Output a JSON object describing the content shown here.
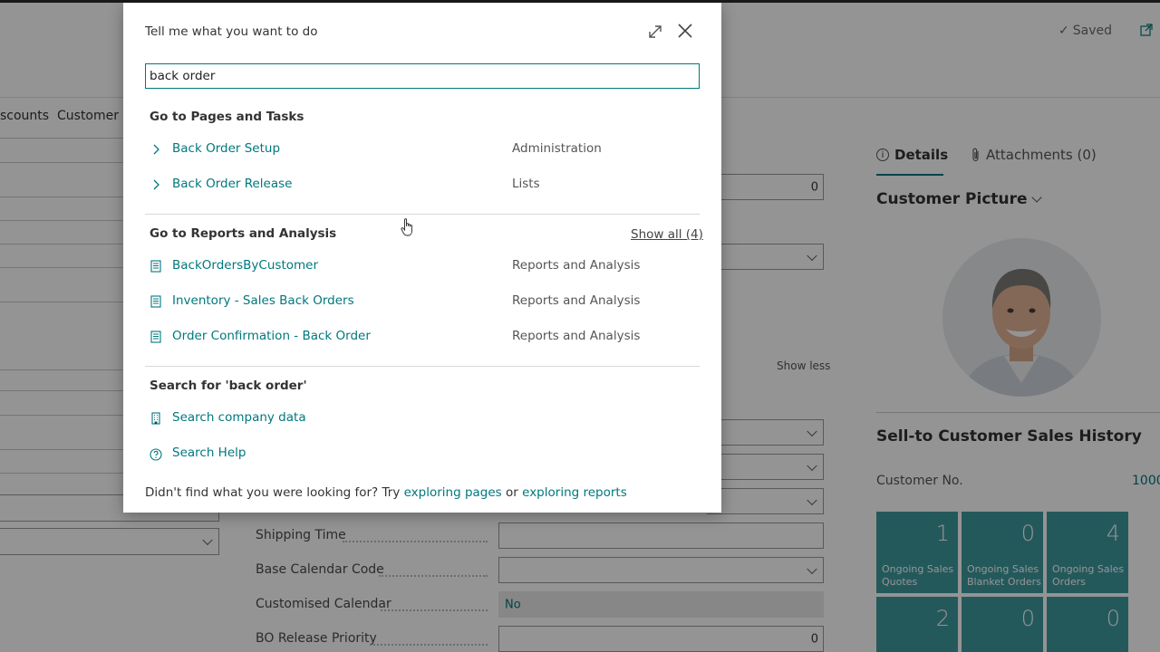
{
  "background": {
    "saved_label": "Saved",
    "nav_actions": [
      "scounts",
      "Customer"
    ],
    "numeric_field_value": "0",
    "show_less": "Show less",
    "fields": [
      {
        "label": "Shipping Time",
        "value": ""
      },
      {
        "label": "Base Calendar Code",
        "value": ""
      },
      {
        "label": "Customised Calendar",
        "value": "No"
      },
      {
        "label": "BO Release Priority",
        "value": "0"
      }
    ],
    "factbox": {
      "tabs": [
        "Details",
        "Attachments (0)"
      ],
      "picture_title": "Customer Picture",
      "history_title": "Sell-to Customer Sales History",
      "customer_no_label": "Customer No.",
      "customer_no_value": "1000",
      "cues": [
        {
          "value": "1",
          "label": "Ongoing Sales Quotes"
        },
        {
          "value": "0",
          "label": "Ongoing Sales Blanket Orders"
        },
        {
          "value": "4",
          "label": "Ongoing Sales Orders"
        },
        {
          "value": "2",
          "label": ""
        },
        {
          "value": "0",
          "label": ""
        },
        {
          "value": "0",
          "label": ""
        }
      ]
    }
  },
  "dialog": {
    "title": "Tell me what you want to do",
    "search_value": "back order",
    "pages_heading": "Go to Pages and Tasks",
    "pages": [
      {
        "name": "Back Order Setup",
        "category": "Administration",
        "icon": "chevron-right-icon"
      },
      {
        "name": "Back Order Release",
        "category": "Lists",
        "icon": "chevron-right-icon"
      }
    ],
    "reports_heading": "Go to Reports and Analysis",
    "show_all": "Show all (4)",
    "reports": [
      {
        "name": "BackOrdersByCustomer",
        "category": "Reports and Analysis",
        "icon": "report-icon"
      },
      {
        "name": "Inventory - Sales Back Orders",
        "category": "Reports and Analysis",
        "icon": "report-icon"
      },
      {
        "name": "Order Confirmation - Back Order",
        "category": "Reports and Analysis",
        "icon": "report-icon"
      }
    ],
    "search_heading": "Search for 'back order'",
    "search_options": [
      {
        "name": "Search company data",
        "icon": "building-icon"
      },
      {
        "name": "Search Help",
        "icon": "help-icon"
      }
    ],
    "footer": {
      "prefix": "Didn't find what you were looking for? Try ",
      "link1": "exploring pages",
      "middle": " or ",
      "link2": "exploring reports"
    }
  },
  "colors": {
    "accent": "#00787c",
    "cue_tile": "#3e999f"
  }
}
